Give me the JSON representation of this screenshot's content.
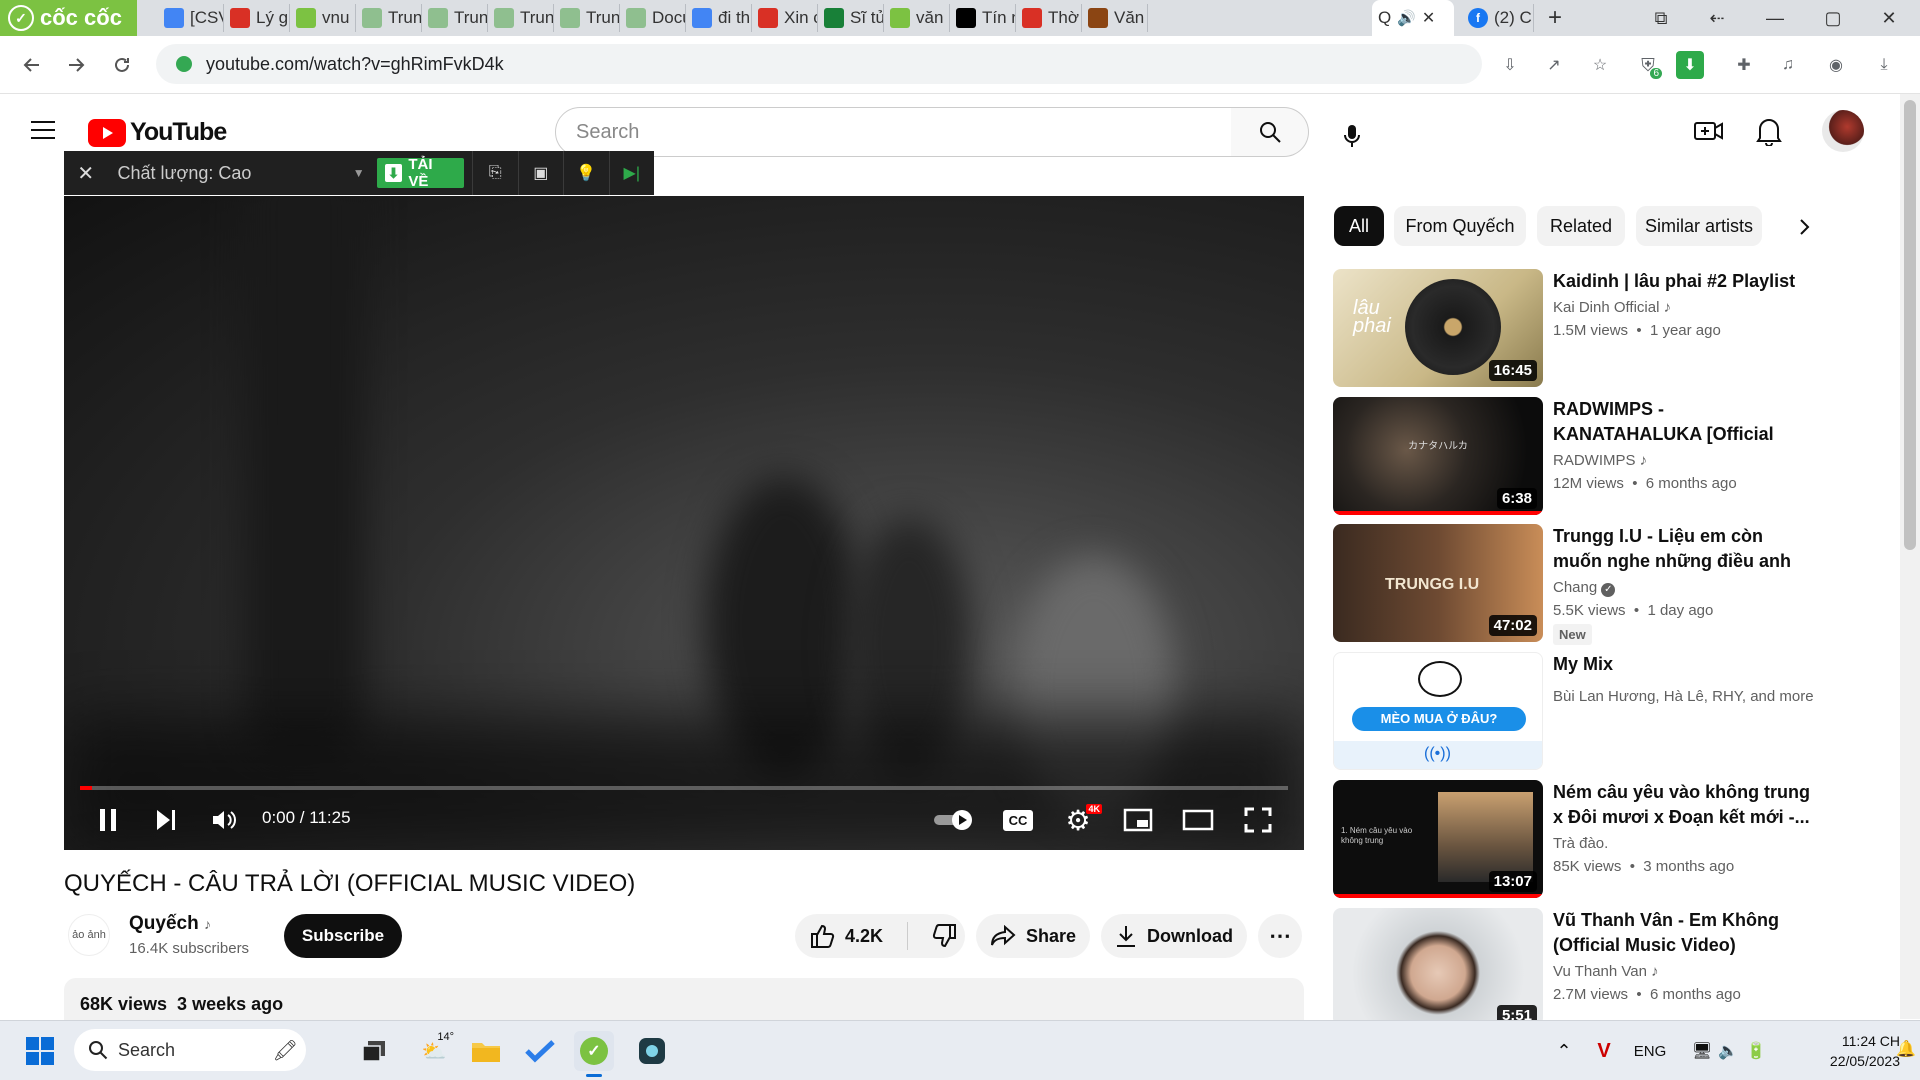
{
  "browser": {
    "brand": "cốc cốc",
    "tabs": [
      {
        "label": "[CSV",
        "fav_color": "#4285f4"
      },
      {
        "label": "Lý gi",
        "fav_color": "#d93025"
      },
      {
        "label": "vnu",
        "fav_color": "#7cc242"
      },
      {
        "label": "Trun",
        "fav_color": "#8fbf8f"
      },
      {
        "label": "Trun",
        "fav_color": "#8fbf8f"
      },
      {
        "label": "Trun",
        "fav_color": "#8fbf8f"
      },
      {
        "label": "Trun",
        "fav_color": "#8fbf8f"
      },
      {
        "label": "Docu",
        "fav_color": "#8fbf8f"
      },
      {
        "label": "đi th",
        "fav_color": "#4285f4"
      },
      {
        "label": "Xin c",
        "fav_color": "#d93025"
      },
      {
        "label": "Sĩ tử",
        "fav_color": "#188038"
      },
      {
        "label": "văn",
        "fav_color": "#7cc242"
      },
      {
        "label": "Tín n",
        "fav_color": "#000000"
      },
      {
        "label": "Thờ",
        "fav_color": "#d93025"
      },
      {
        "label": "Văn",
        "fav_color": "#8b4513"
      }
    ],
    "active_tab_label": "Q",
    "next_tab_label": "(2) C",
    "url": "youtube.com/watch?v=ghRimFvkD4k",
    "ext_badge": "6"
  },
  "youtube": {
    "logo_text": "YouTube",
    "search_placeholder": "Search"
  },
  "downloader": {
    "quality": "Chất lượng: Cao",
    "download_label": "TẢI VỀ"
  },
  "player": {
    "time": "0:00 / 11:25",
    "progress": 0.01,
    "hd_badge": "4K"
  },
  "video": {
    "title": "QUYẾCH - CÂU TRẢ LỜI (OFFICIAL MUSIC VIDEO)",
    "channel": "Quyếch",
    "channel_avatar_text": "ảo ảnh",
    "subscribers": "16.4K subscribers",
    "subscribe_label": "Subscribe",
    "likes": "4.2K",
    "share_label": "Share",
    "download_label": "Download",
    "views_date": "68K views  3 weeks ago"
  },
  "chips": [
    "All",
    "From Quyếch",
    "Related",
    "Similar artists"
  ],
  "recommendations": [
    {
      "title": "Kaidinh | lâu phai #2 Playlist",
      "channel": "Kai Dinh Official",
      "meta": "1.5M views  •  1 year ago",
      "duration": "16:45",
      "thumb_text": "lâu phai",
      "badge": ""
    },
    {
      "title": "RADWIMPS - KANATAHALUKA [Official Music Video]",
      "channel": "RADWIMPS",
      "meta": "12M views  •  6 months ago",
      "duration": "6:38",
      "thumb_text": "カナタハルカ",
      "badge": ""
    },
    {
      "title": "Trungg I.U - Liệu em còn muốn nghe những điều anh nói... / F...",
      "channel": "Chang",
      "meta": "5.5K views  •  1 day ago",
      "duration": "47:02",
      "thumb_text": "TRUNGG I.U",
      "badge": "New"
    },
    {
      "title": "My Mix",
      "channel": "Bùi Lan Hương, Hà Lê, RHY, and more",
      "meta": "",
      "duration": "",
      "thumb_text": "MÈO MUA Ở ĐÂU?",
      "badge": ""
    },
    {
      "title": "Ném câu yêu vào không trung x Đôi mươi x Đoạn kết mới -...",
      "channel": "Trà đào.",
      "meta": "85K views  •  3 months ago",
      "duration": "13:07",
      "thumb_text": "1. Ném câu yêu vào không trung",
      "badge": ""
    },
    {
      "title": "Vũ Thanh Vân - Em Không (Official Music Video)",
      "channel": "Vu Thanh Van",
      "meta": "2.7M views  •  6 months ago",
      "duration": "5:51",
      "thumb_text": "",
      "badge": ""
    }
  ],
  "taskbar": {
    "search_label": "Search",
    "weather": "14°",
    "lang": "ENG",
    "time": "11:24 CH",
    "date": "22/05/2023"
  }
}
